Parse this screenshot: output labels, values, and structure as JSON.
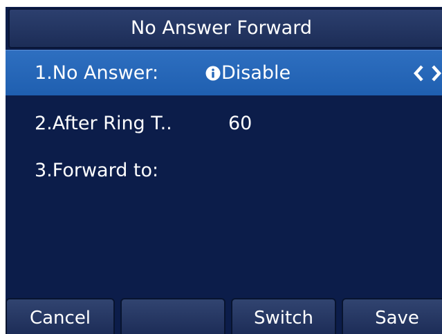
{
  "screen_title": "No Answer Forward",
  "rows": [
    {
      "label": "1.No Answer:",
      "value": "Disable",
      "selected": true,
      "info_icon": "info-icon",
      "nav_icon": "left-right-chevron-icon"
    },
    {
      "label": "2.After Ring T..",
      "value": "60",
      "selected": false
    },
    {
      "label": "3.Forward to:",
      "value": "",
      "selected": false
    }
  ],
  "softkeys": {
    "key1": "Cancel",
    "key2": "",
    "key3": "Switch",
    "key4": "Save"
  },
  "colors": {
    "background": "#0c1d4a",
    "selected_row": "#2566b8",
    "text": "#ffffff"
  }
}
